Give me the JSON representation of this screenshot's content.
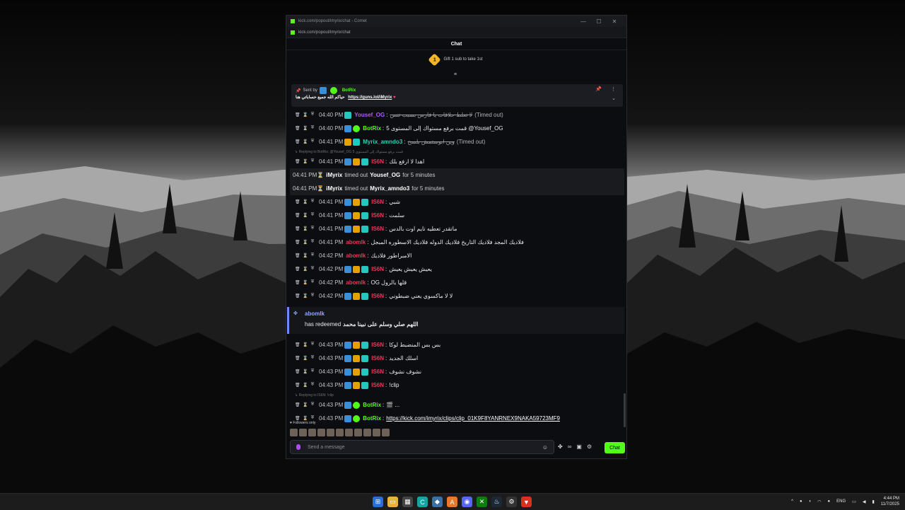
{
  "window": {
    "title": "kick.com/popout/imyrix/chat - Comet",
    "address": "kick.com/popout/imyrix/chat",
    "minimize": "—",
    "maximize": "☐",
    "close": "✕"
  },
  "chat": {
    "header": "Chat",
    "gift_number": "1",
    "gift_text": "Gift 1 sub to take 1st"
  },
  "pinned": {
    "sent_by": "Sent by",
    "user": "BotRix",
    "text": "حياكم الله جميع حساباتي هنا",
    "link": "https://guns.lol/iMyrix",
    "heart": "♥"
  },
  "messages": [
    {
      "time": "04:40 PM",
      "user": "Yousef_OG",
      "user_color": "purple",
      "badges": [
        "cyan"
      ],
      "text": "لا تغلط حلاقات يا فارس بسبب تنس",
      "strike": true,
      "suffix": "(Timed out)"
    },
    {
      "time": "04:40 PM",
      "user": "BotRix",
      "user_color": "green",
      "badges": [
        "blue",
        "green"
      ],
      "text": "قمت برفع مستواك إلى المستوى 5 @Yousef_OG"
    },
    {
      "time": "04:41 PM",
      "user": "Myrix_amndo3",
      "user_color": "teal",
      "badges": [
        "gold",
        "cyan"
      ],
      "text": "وين ابوستمش بلسح",
      "strike": true,
      "suffix": "(Timed out)"
    },
    {
      "reply": "Replying to BotRix: @Yousef_OG 5 قمت برفع مستواك إلى المستوى",
      "time": "04:41 PM",
      "user": "IS6N",
      "user_color": "red",
      "badges": [
        "blue",
        "gold",
        "cyan"
      ],
      "text": "اهدا لا ارفع بلك"
    },
    {
      "sys": true,
      "time": "04:41 PM",
      "actor": "iMyrix",
      "action": "timed out",
      "target": "Yousef_OG",
      "duration": "for 5 minutes"
    },
    {
      "sys": true,
      "time": "04:41 PM",
      "actor": "iMyrix",
      "action": "timed out",
      "target": "Myrix_amndo3",
      "duration": "for 5 minutes"
    },
    {
      "time": "04:41 PM",
      "user": "IS6N",
      "user_color": "red",
      "badges": [
        "blue",
        "gold",
        "cyan"
      ],
      "text": "شبي"
    },
    {
      "time": "04:41 PM",
      "user": "IS6N",
      "user_color": "red",
      "badges": [
        "blue",
        "gold",
        "cyan"
      ],
      "text": "سلمت"
    },
    {
      "time": "04:41 PM",
      "user": "IS6N",
      "user_color": "red",
      "badges": [
        "blue",
        "gold",
        "cyan"
      ],
      "text": "ماتقدر تعطيه تايم اوت بالدس"
    },
    {
      "time": "04:41 PM",
      "user": "abomlk",
      "user_color": "red",
      "badges": [],
      "text": "فلاديك المجد فلاديك التاريخ فلاديك الدوله فلاديك الاسطوره المبجل"
    },
    {
      "time": "04:42 PM",
      "user": "abomlk",
      "user_color": "red",
      "badges": [],
      "text": "الامبراطور فلاديك"
    },
    {
      "time": "04:42 PM",
      "user": "IS6N",
      "user_color": "red",
      "badges": [
        "blue",
        "gold",
        "cyan"
      ],
      "text": "يعيش يعيش يعيش"
    },
    {
      "time": "04:42 PM",
      "user": "abomlk",
      "user_color": "red",
      "badges": [],
      "text": "OG قلها بالرول"
    },
    {
      "time": "04:42 PM",
      "user": "IS6N",
      "user_color": "red",
      "badges": [
        "blue",
        "gold",
        "cyan"
      ],
      "text": "لا لا ماكسوي يعني ضبطوني"
    },
    {
      "redeem": true,
      "user": "abomlk",
      "text": "has redeemed",
      "reward": "اللهم صلي وسلم على نبينا محمد"
    },
    {
      "time": "04:43 PM",
      "user": "IS6N",
      "user_color": "red",
      "badges": [
        "blue",
        "gold",
        "cyan"
      ],
      "text": "بس بس المنضبط لوكا"
    },
    {
      "time": "04:43 PM",
      "user": "IS6N",
      "user_color": "red",
      "badges": [
        "blue",
        "gold",
        "cyan"
      ],
      "text": "اسلك الجديد"
    },
    {
      "time": "04:43 PM",
      "user": "IS6N",
      "user_color": "red",
      "badges": [
        "blue",
        "gold",
        "cyan"
      ],
      "text": "نشوف نشوف"
    },
    {
      "time": "04:43 PM",
      "user": "IS6N",
      "user_color": "red",
      "badges": [
        "blue",
        "gold",
        "cyan"
      ],
      "text": "!clip"
    },
    {
      "reply": "Replying to IS6N: !clip",
      "time": "04:43 PM",
      "user": "BotRix",
      "user_color": "green",
      "badges": [
        "blue",
        "green"
      ],
      "text": "🎬 ..."
    },
    {
      "time": "04:43 PM",
      "user": "BotRix",
      "user_color": "green",
      "badges": [
        "blue",
        "green"
      ],
      "link": "https://kick.com/imyrix/clips/clip_01K9F8YANRNEX9NAKA59723MF9"
    }
  ],
  "footer": {
    "followers_only": "♥ Followers only",
    "placeholder": "Send a message",
    "chat_button": "Chat"
  },
  "taskbar": {
    "lang": "ENG",
    "time": "4:44 PM",
    "date": "11/7/2025"
  },
  "colors": {
    "accent": "#53fc18",
    "bg": "#0c0d10"
  }
}
